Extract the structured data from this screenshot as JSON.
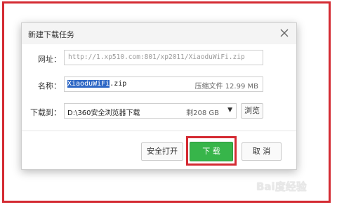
{
  "dialog": {
    "title": "新建下载任务",
    "url_label": "网址：",
    "url_value": "http://1.xp510.com:801/xp2011/XiaoduWiFi.zip",
    "name_label": "名称：",
    "name_selected": "XiaoduWiFi",
    "name_ext": ".zip",
    "file_info": "压缩文件 12.99 MB",
    "path_label": "下载到：",
    "path_value": "D:\\360安全浏览器下载",
    "free_space": "剩208 GB",
    "browse_label": "浏览",
    "safe_open_label": "安全打开",
    "download_label": "下 载",
    "cancel_label": "取 消"
  },
  "watermark": "Bai度经验",
  "colors": {
    "highlight": "#d42a32",
    "download": "#37b54a",
    "selection": "#2f68c5"
  }
}
